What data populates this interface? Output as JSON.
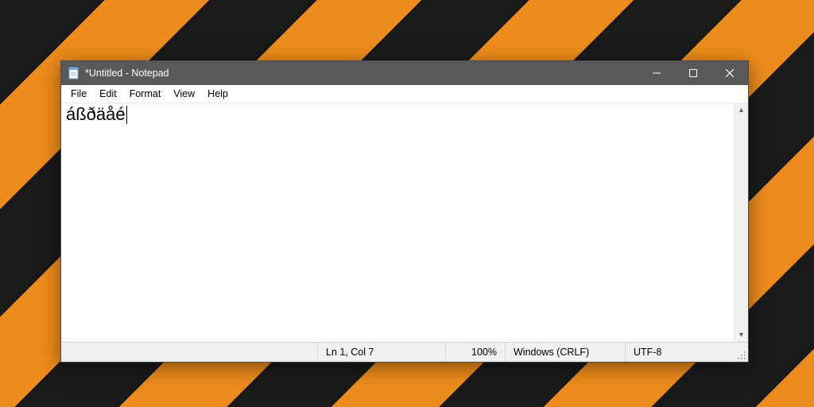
{
  "titlebar": {
    "icon": "notepad-icon",
    "title": "*Untitled - Notepad"
  },
  "window_controls": {
    "minimize": "minimize",
    "maximize": "maximize",
    "close": "close"
  },
  "menu": {
    "file": "File",
    "edit": "Edit",
    "format": "Format",
    "view": "View",
    "help": "Help"
  },
  "editor": {
    "content": "áßðäåé"
  },
  "status": {
    "position": "Ln 1, Col 7",
    "zoom": "100%",
    "line_ending": "Windows (CRLF)",
    "encoding": "UTF-8"
  }
}
